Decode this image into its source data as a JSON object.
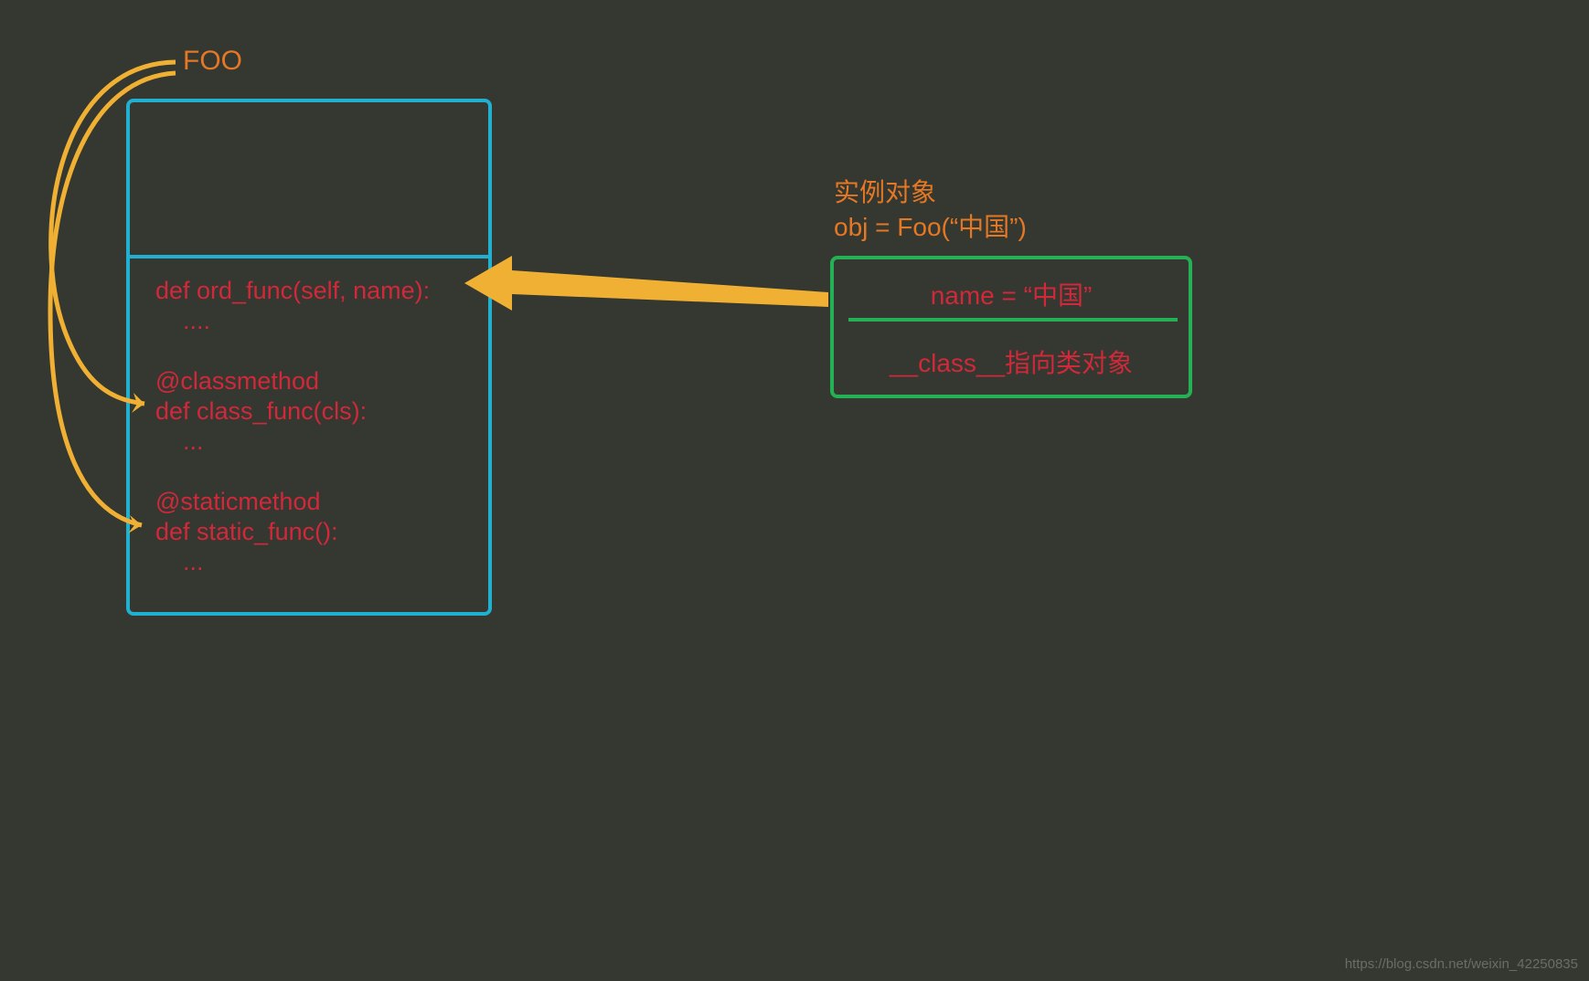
{
  "fooLabel": "FOO",
  "classBox": {
    "codeLines": "def ord_func(self, name):\n    ....\n\n@classmethod\ndef class_func(cls):\n    ...\n\n@staticmethod\ndef static_func():\n    ..."
  },
  "instanceLabel": {
    "line1": "实例对象",
    "line2": "obj = Foo(“中国”)"
  },
  "instanceBox": {
    "row1": "name = “中国”",
    "row2": "__class__指向类对象"
  },
  "watermark": "https://blog.csdn.net/weixin_42250835",
  "colors": {
    "background": "#343830",
    "orange": "#e57825",
    "blue": "#21b0cf",
    "green": "#24b155",
    "red": "#d1283a",
    "arrow": "#f0b033"
  }
}
